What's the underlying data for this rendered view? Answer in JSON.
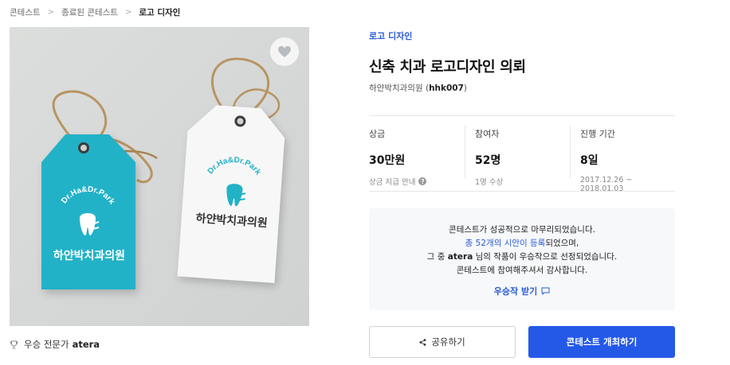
{
  "breadcrumb": {
    "items": [
      "콘테스트",
      "종료된 콘테스트",
      "로고 디자인"
    ]
  },
  "image": {
    "teal_tag_brand": "Dr.Ha&Dr.Park",
    "teal_tag_name": "하얀박치과의원",
    "white_tag_brand": "Dr.Ha&Dr.Park",
    "white_tag_name": "하얀박치과의원",
    "colors": {
      "teal": "#23b2c7",
      "white_tag": "#f7f7f7",
      "string": "#b89462"
    }
  },
  "expert": {
    "label": "우승 전문가",
    "name": "atera"
  },
  "contest": {
    "category": "로고 디자인",
    "title": "신축 치과 로고디자인 의뢰",
    "client": "하얀박치과의원",
    "client_id": "hhk007"
  },
  "stats": {
    "prize_label": "상금",
    "prize_value": "30만원",
    "prize_sub": "상금 지급 안내",
    "participants_label": "참여자",
    "participants_value": "52명",
    "participants_sub": "1명 수상",
    "period_label": "진행 기간",
    "period_value": "8일",
    "period_sub": "2017.12.26 ~ 2018.01.03"
  },
  "notice": {
    "line1": "콘테스트가 성공적으로 마무리되었습니다.",
    "line2_link": "총 52개의 시안이 등록",
    "line2_rest": "되었으며,",
    "line3_pre": "그 중",
    "line3_name": "atera",
    "line3_post": "님의 작품이 우승작으로 선정되었습니다.",
    "line4": "콘테스트에 참여해주셔서 감사합니다.",
    "cta": "우승작 받기"
  },
  "buttons": {
    "share": "공유하기",
    "host": "콘테스트 개최하기"
  },
  "colors": {
    "accent": "#2459e8",
    "link": "#2a5bd7"
  }
}
